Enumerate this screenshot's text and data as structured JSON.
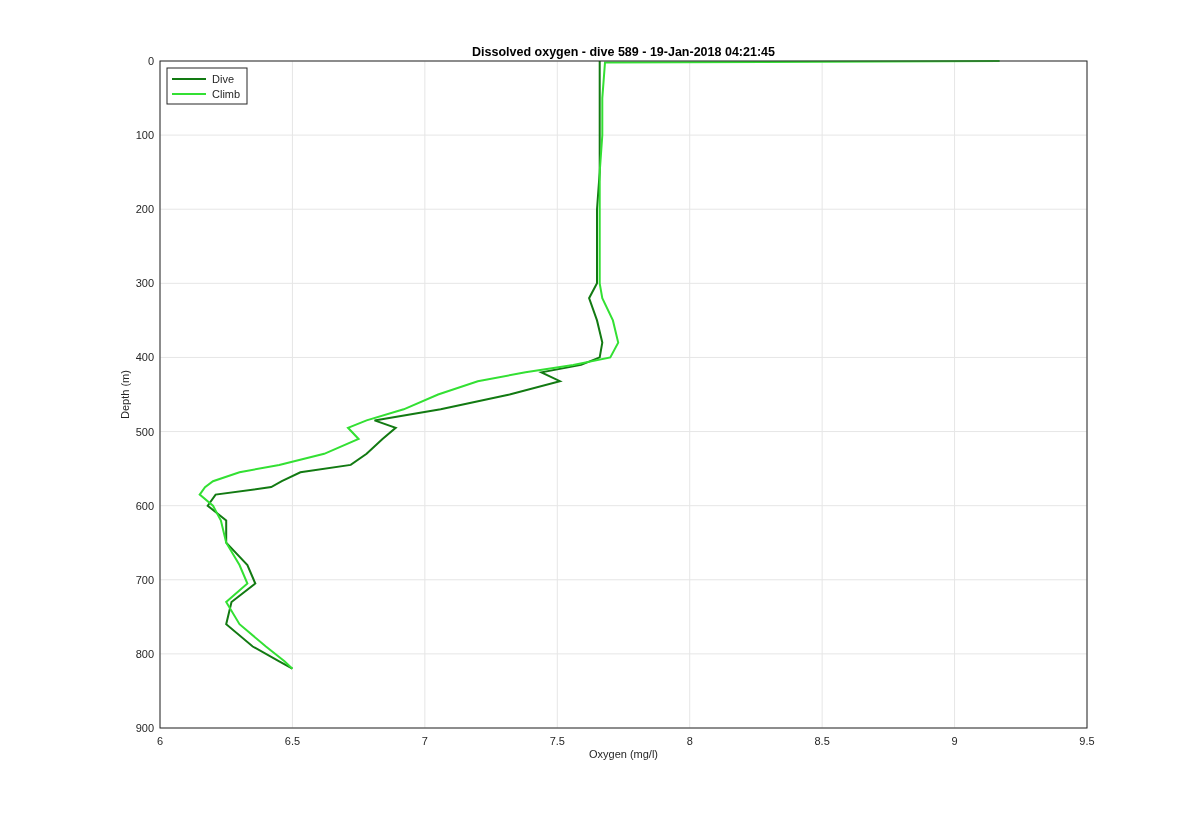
{
  "figure": {
    "chart_data": {
      "type": "line",
      "orientation": "horizontal",
      "title": "Dissolved oxygen - dive 589 - 19-Jan-2018 04:21:45",
      "xlabel": "Oxygen (mg/l)",
      "ylabel": "Depth (m)",
      "x": [
        0,
        2,
        50,
        100,
        150,
        200,
        250,
        300,
        320,
        350,
        380,
        400,
        410,
        420,
        432,
        450,
        470,
        485,
        495,
        510,
        530,
        545,
        555,
        567,
        575,
        585,
        600,
        620,
        650,
        680,
        705,
        730,
        760,
        790,
        810,
        820
      ],
      "series": [
        {
          "name": "Dive",
          "color": "#127a12",
          "values": [
            7.66,
            7.66,
            7.66,
            7.66,
            7.66,
            7.65,
            7.65,
            7.65,
            7.62,
            7.65,
            7.67,
            7.66,
            7.59,
            7.44,
            7.51,
            7.32,
            7.06,
            6.81,
            6.89,
            6.84,
            6.78,
            6.72,
            6.53,
            6.46,
            6.42,
            6.21,
            6.18,
            6.25,
            6.25,
            6.33,
            6.36,
            6.27,
            6.25,
            6.35,
            6.45,
            6.5
          ]
        },
        {
          "name": "Climb",
          "color": "#33e033",
          "values": [
            9.17,
            7.68,
            7.67,
            7.67,
            7.66,
            7.66,
            7.66,
            7.66,
            7.67,
            7.71,
            7.73,
            7.7,
            7.56,
            7.38,
            7.2,
            7.05,
            6.92,
            6.78,
            6.71,
            6.75,
            6.62,
            6.45,
            6.3,
            6.2,
            6.17,
            6.15,
            6.2,
            6.23,
            6.25,
            6.3,
            6.33,
            6.25,
            6.3,
            6.4,
            6.47,
            6.5
          ]
        }
      ],
      "xlim": [
        6,
        9.5
      ],
      "ylim": [
        900,
        0
      ],
      "grid": true,
      "legend": true,
      "xticks": [
        6,
        6.5,
        7,
        7.5,
        8,
        8.5,
        9,
        9.5
      ],
      "yticks": [
        0,
        100,
        200,
        300,
        400,
        500,
        600,
        700,
        800,
        900
      ]
    }
  }
}
